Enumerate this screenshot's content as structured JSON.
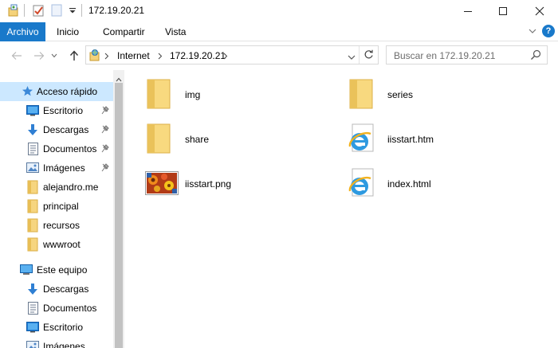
{
  "window": {
    "title": "172.19.20.21",
    "colors": {
      "accent": "#1979ca",
      "selection": "#cce8ff",
      "folder": "#f4d27a"
    }
  },
  "ribbon": {
    "file_tab": "Archivo",
    "tabs": [
      "Inicio",
      "Compartir",
      "Vista"
    ]
  },
  "address": {
    "crumbs": [
      "Internet",
      "172.19.20.21"
    ],
    "search_placeholder": "Buscar en 172.19.20.21"
  },
  "sidebar": {
    "quick_access": "Acceso rápido",
    "quick_items": [
      {
        "label": "Escritorio",
        "icon": "desktop-icon",
        "pinned": true
      },
      {
        "label": "Descargas",
        "icon": "downloads-icon",
        "pinned": true
      },
      {
        "label": "Documentos",
        "icon": "documents-icon",
        "pinned": true
      },
      {
        "label": "Imágenes",
        "icon": "pictures-icon",
        "pinned": true
      },
      {
        "label": "alejandro.me",
        "icon": "folder-icon",
        "pinned": false
      },
      {
        "label": "principal",
        "icon": "folder-icon",
        "pinned": false
      },
      {
        "label": "recursos",
        "icon": "folder-icon",
        "pinned": false
      },
      {
        "label": "wwwroot",
        "icon": "folder-icon",
        "pinned": false
      }
    ],
    "this_pc": "Este equipo",
    "pc_items": [
      {
        "label": "Descargas",
        "icon": "downloads-icon"
      },
      {
        "label": "Documentos",
        "icon": "documents-icon"
      },
      {
        "label": "Escritorio",
        "icon": "desktop-icon"
      },
      {
        "label": "Imágenes",
        "icon": "pictures-icon"
      }
    ]
  },
  "files": [
    {
      "name": "img",
      "type": "folder"
    },
    {
      "name": "series",
      "type": "folder"
    },
    {
      "name": "share",
      "type": "folder"
    },
    {
      "name": "iisstart.htm",
      "type": "ie"
    },
    {
      "name": "iisstart.png",
      "type": "image"
    },
    {
      "name": "index.html",
      "type": "ie"
    }
  ]
}
